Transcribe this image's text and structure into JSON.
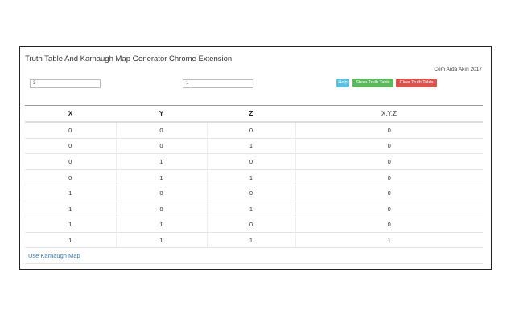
{
  "header": {
    "title": "Truth Table And Karnaugh Map Generator Chrome Extension",
    "credit": "Cem Arda Akın 2017"
  },
  "inputs": {
    "variables_value": "3",
    "outputs_value": "1"
  },
  "buttons": {
    "help": "Help",
    "show": "Show Truth Table",
    "clear": "Clear Truth Table"
  },
  "colors": {
    "help": "#5bc0de",
    "show": "#5cb85c",
    "clear": "#d9534f",
    "link": "#337ab7"
  },
  "table": {
    "headers": [
      "X",
      "Y",
      "Z",
      "X.Y.Z"
    ],
    "rows": [
      [
        "0",
        "0",
        "0",
        "0"
      ],
      [
        "0",
        "0",
        "1",
        "0"
      ],
      [
        "0",
        "1",
        "0",
        "0"
      ],
      [
        "0",
        "1",
        "1",
        "0"
      ],
      [
        "1",
        "0",
        "0",
        "0"
      ],
      [
        "1",
        "0",
        "1",
        "0"
      ],
      [
        "1",
        "1",
        "0",
        "0"
      ],
      [
        "1",
        "1",
        "1",
        "1"
      ]
    ]
  },
  "footer": {
    "kmap_link": "Use Karnaugh Map"
  }
}
